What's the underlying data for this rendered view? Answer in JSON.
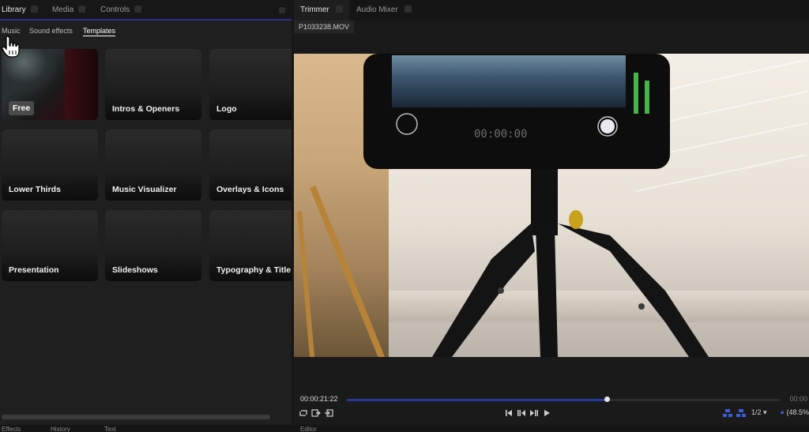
{
  "library_panel": {
    "tabs": [
      {
        "label": "Library",
        "active": true
      },
      {
        "label": "Media",
        "active": false
      },
      {
        "label": "Controls",
        "active": false
      }
    ],
    "subtabs": [
      {
        "label": "Music",
        "active": false
      },
      {
        "label": "Sound effects",
        "active": false
      },
      {
        "label": "Templates",
        "active": true
      }
    ],
    "tiles": [
      {
        "label": "Free",
        "badge": true
      },
      {
        "label": "Intros & Openers"
      },
      {
        "label": "Logo"
      },
      {
        "label": "Lower Thirds"
      },
      {
        "label": "Music Visualizer"
      },
      {
        "label": "Overlays & Icons"
      },
      {
        "label": "Presentation"
      },
      {
        "label": "Slideshows"
      },
      {
        "label": "Typography & Title"
      }
    ],
    "bottom_tabs": [
      {
        "label": "Effects"
      },
      {
        "label": "History"
      },
      {
        "label": "Text"
      }
    ]
  },
  "viewer_panel": {
    "tabs": [
      {
        "label": "Trimmer",
        "active": true
      },
      {
        "label": "Audio Mixer",
        "active": false
      }
    ],
    "filename": "P1033238.MOV",
    "phone_timer": "00:00:00",
    "timecode": "00:00:21:22",
    "timecode_end": "00:00",
    "playhead_fraction": 0.6,
    "resolution": "1/2",
    "zoom": "(48.5%",
    "bottom_tab": "Editor"
  },
  "colors": {
    "accent": "#2f2f8f",
    "meter_green": "#47b34a",
    "background": "#161616"
  }
}
